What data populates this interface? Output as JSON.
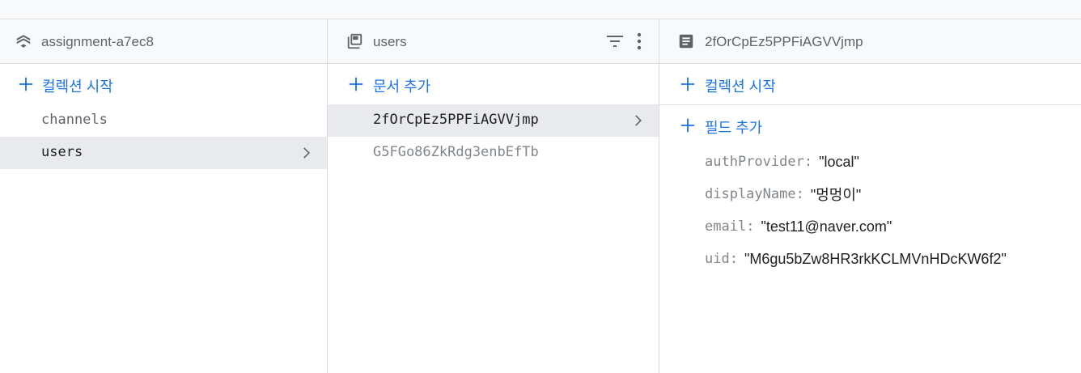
{
  "panels": {
    "root": {
      "title": "assignment-a7ec8",
      "icon": "firestore-stack-icon",
      "add_label": "컬렉션 시작",
      "items": [
        "channels",
        "users"
      ],
      "selected": "users"
    },
    "collection": {
      "title": "users",
      "icon": "collection-icon",
      "add_label": "문서 추가",
      "items": [
        "2fOrCpEz5PPFiAGVVjmp",
        "G5FGo86ZkRdg3enbEfTb"
      ],
      "selected": "2fOrCpEz5PPFiAGVVjmp"
    },
    "document": {
      "title": "2fOrCpEz5PPFiAGVVjmp",
      "icon": "document-icon",
      "add_collection_label": "컬렉션 시작",
      "add_field_label": "필드 추가",
      "fields": [
        {
          "key": "authProvider",
          "value": "\"local\""
        },
        {
          "key": "displayName",
          "value": "\"멍멍이\""
        },
        {
          "key": "email",
          "value": "\"test11@naver.com\""
        },
        {
          "key": "uid",
          "value": "\"M6gu5bZw8HR3rkKCLMVnHDcKW6f2\""
        }
      ]
    }
  },
  "colors": {
    "accent": "#1a73e8",
    "header_bg": "#f8f9fa",
    "selected_bg": "#e8eaed",
    "border": "#dadce0"
  }
}
